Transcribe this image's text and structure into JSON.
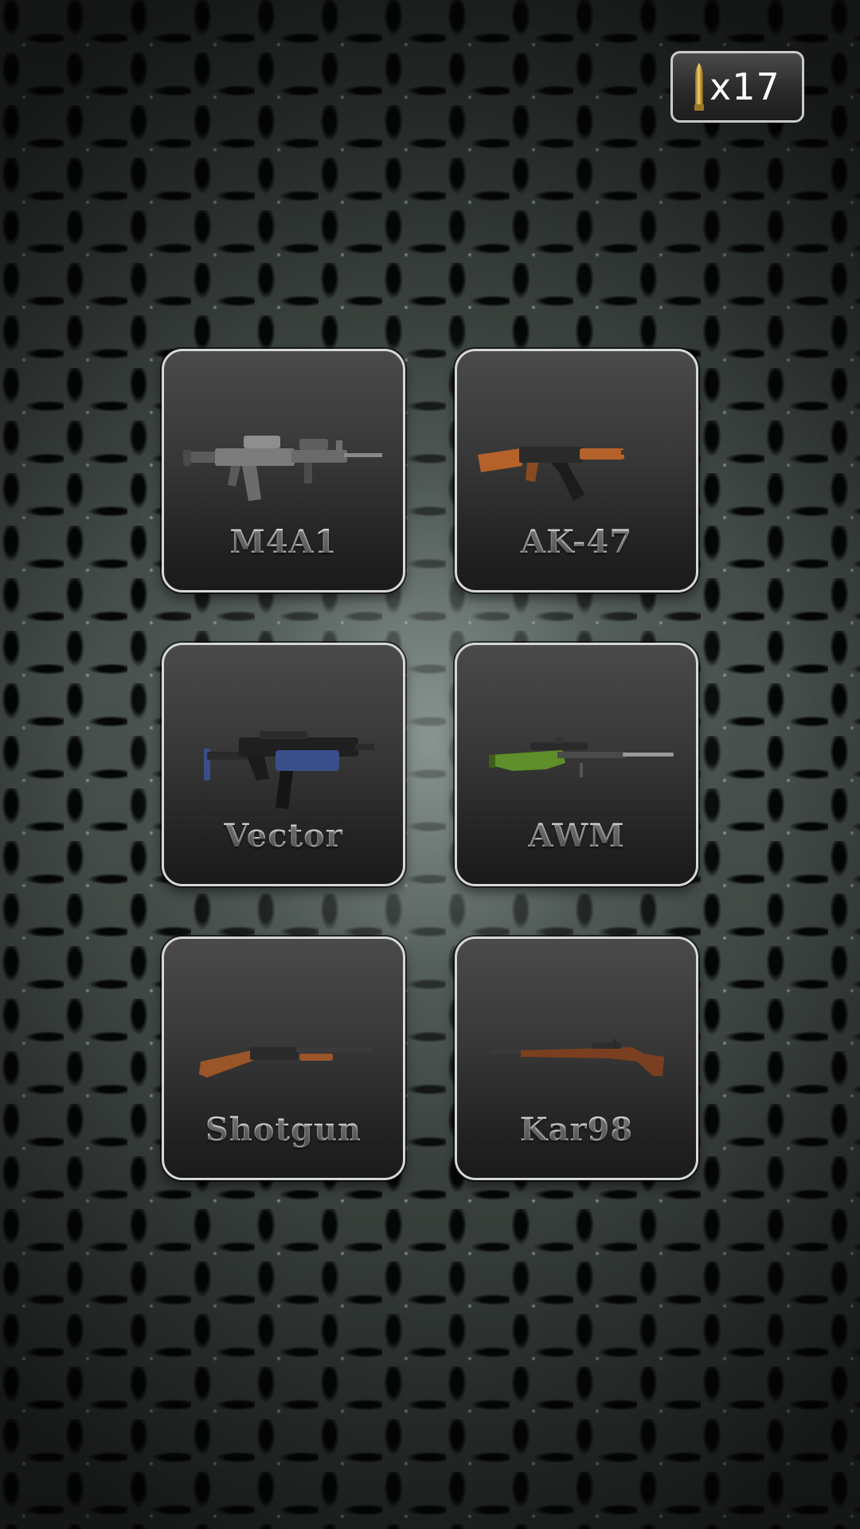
{
  "hud": {
    "ammo_count": "x17",
    "ammo_icon": "bullet-icon",
    "ammo_color": "#d4a93a"
  },
  "weapons": [
    {
      "name": "M4A1",
      "icon": "assault-rifle-icon"
    },
    {
      "name": "AK-47",
      "icon": "ak47-rifle-icon"
    },
    {
      "name": "Vector",
      "icon": "smg-icon"
    },
    {
      "name": "AWM",
      "icon": "sniper-rifle-icon"
    },
    {
      "name": "Shotgun",
      "icon": "shotgun-icon"
    },
    {
      "name": "Kar98",
      "icon": "bolt-action-rifle-icon"
    }
  ]
}
